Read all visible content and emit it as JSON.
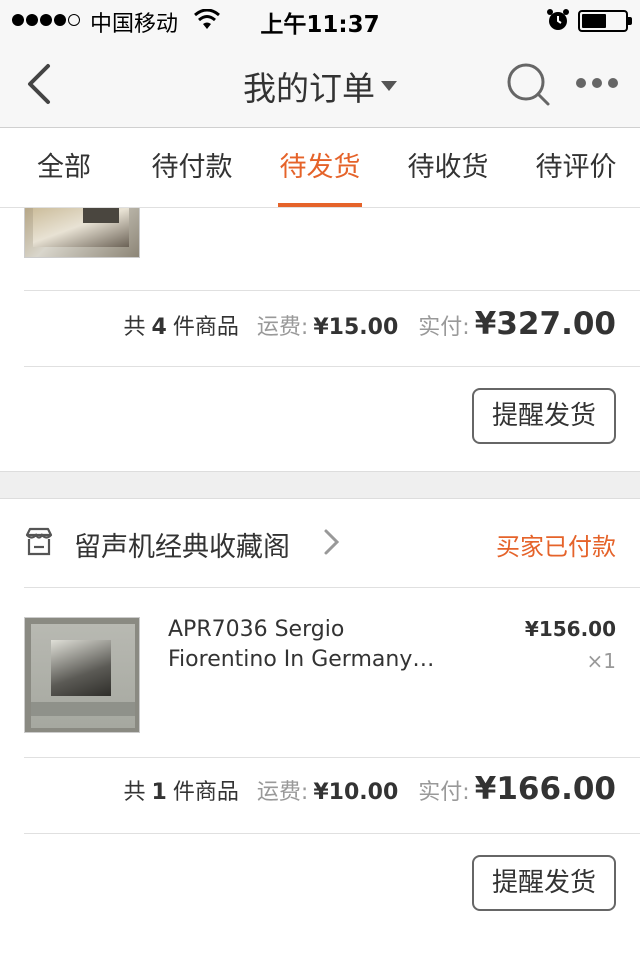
{
  "status_bar": {
    "carrier": "中国移动",
    "time": "上午11:37",
    "icons": [
      "signal-dots-icon",
      "wifi-icon",
      "alarm-icon",
      "battery-icon"
    ]
  },
  "nav": {
    "title": "我的订单",
    "icons": [
      "back-arrow-icon",
      "dropdown-caret-icon",
      "search-icon",
      "more-dots-icon"
    ]
  },
  "tabs": [
    {
      "label": "全部",
      "active": false
    },
    {
      "label": "待付款",
      "active": false
    },
    {
      "label": "待发货",
      "active": true
    },
    {
      "label": "待收货",
      "active": false
    },
    {
      "label": "待评价",
      "active": false
    }
  ],
  "orders": [
    {
      "summary": {
        "count_prefix": "共",
        "count": "4",
        "count_suffix": "件商品",
        "shipping_label": "运费:",
        "shipping_fee": "¥15.00",
        "paid_label": "实付:",
        "paid_total": "¥327.00"
      },
      "remind_label": "提醒发货"
    },
    {
      "shop_name": "留声机经典收藏阁",
      "status": "买家已付款",
      "item": {
        "title_line1": "APR7036 Sergio",
        "title_line2": "Fiorentino In Germany…",
        "price": "¥156.00",
        "quantity": "×1"
      },
      "summary": {
        "count_prefix": "共",
        "count": "1",
        "count_suffix": "件商品",
        "shipping_label": "运费:",
        "shipping_fee": "¥10.00",
        "paid_label": "实付:",
        "paid_total": "¥166.00"
      },
      "remind_label": "提醒发货"
    }
  ],
  "colors": {
    "accent": "#e5632a",
    "background": "#efefef",
    "card": "#ffffff",
    "muted_text": "#999999"
  }
}
